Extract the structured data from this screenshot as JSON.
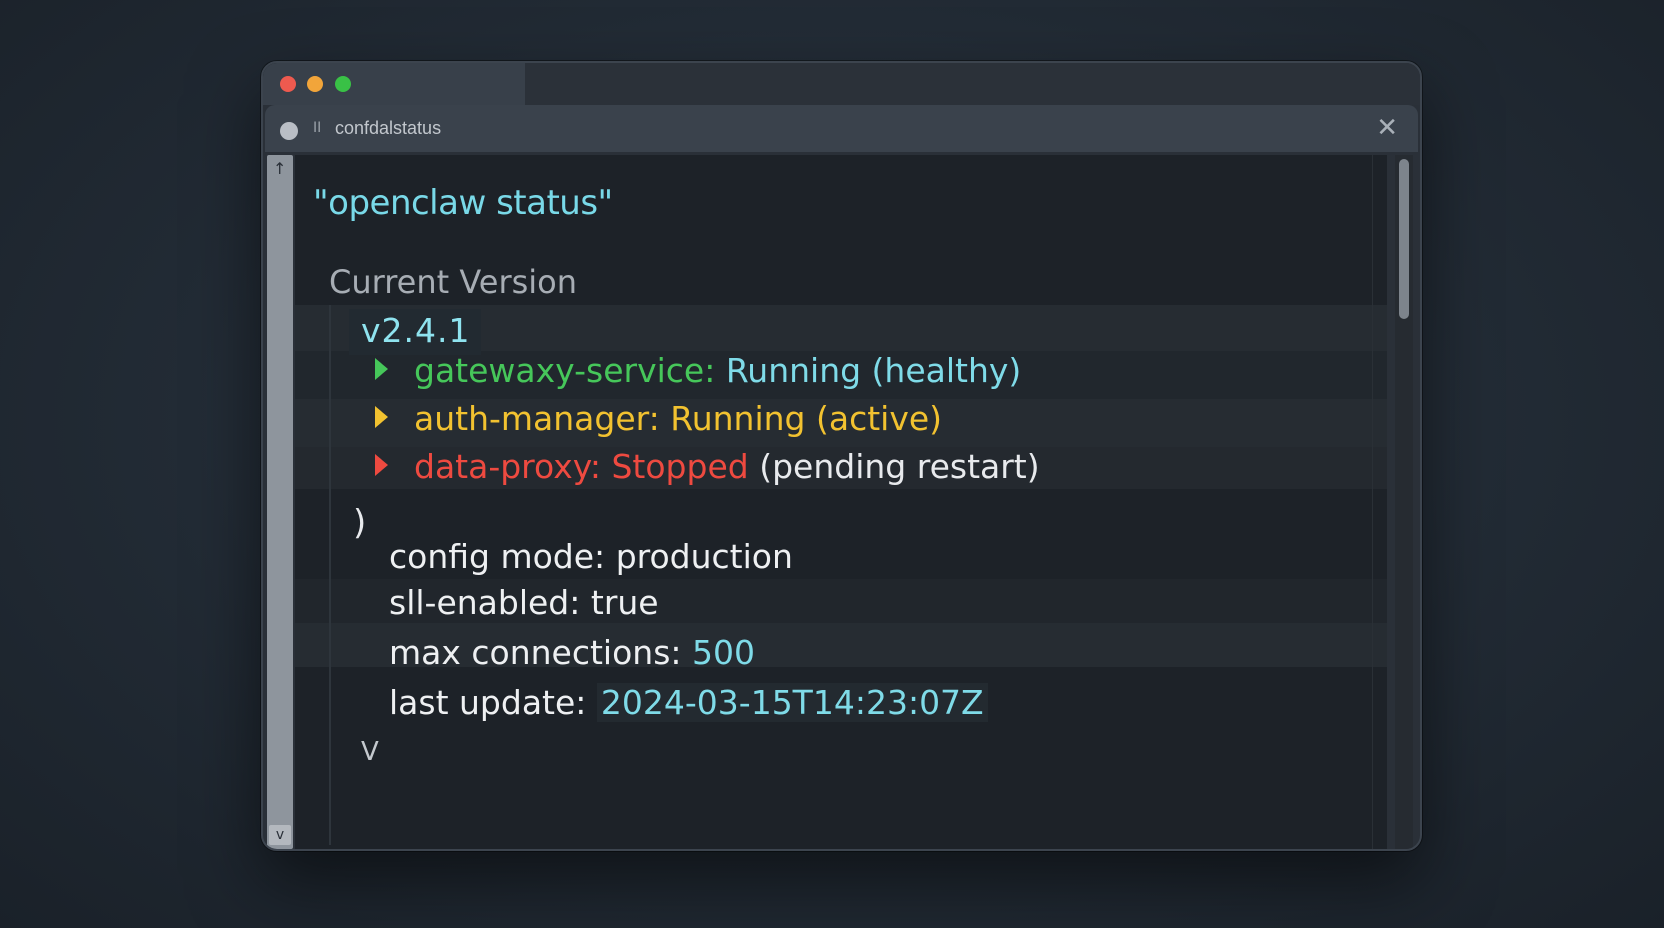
{
  "window": {
    "tab_title": "confdalstatus",
    "tab_pause_glyph": "II",
    "close_glyph": "✕"
  },
  "terminal": {
    "command": "\"openclaw status\"",
    "section_heading": "Current Version",
    "version": "v2.4.1",
    "services": [
      {
        "name": "gatewaxy-service:",
        "state": "Running (healthy)",
        "color": "#46c75a"
      },
      {
        "name": "auth-manager:",
        "state": "Running (active)",
        "color": "#f2c230"
      },
      {
        "name": "data-proxy:",
        "state": "Stopped",
        "note": "(pending restart)",
        "color": "#ee4a40"
      }
    ],
    "closing_paren": ")",
    "config": {
      "mode_key": "config mode:",
      "mode_val": "production",
      "ssl_key": "sll-enabled:",
      "ssl_val": "true",
      "maxconn_key": "max connections:",
      "maxconn_val": "500",
      "update_key": "last update:",
      "update_val": "2024-03-15T14:23:07Z"
    },
    "more_glyph": "V"
  },
  "gutter": {
    "up_glyph": "↑",
    "down_glyph": "v"
  },
  "icons": {
    "traffic_lights": [
      "red-close-icon",
      "yellow-minimize-icon",
      "green-maximize-icon"
    ]
  }
}
